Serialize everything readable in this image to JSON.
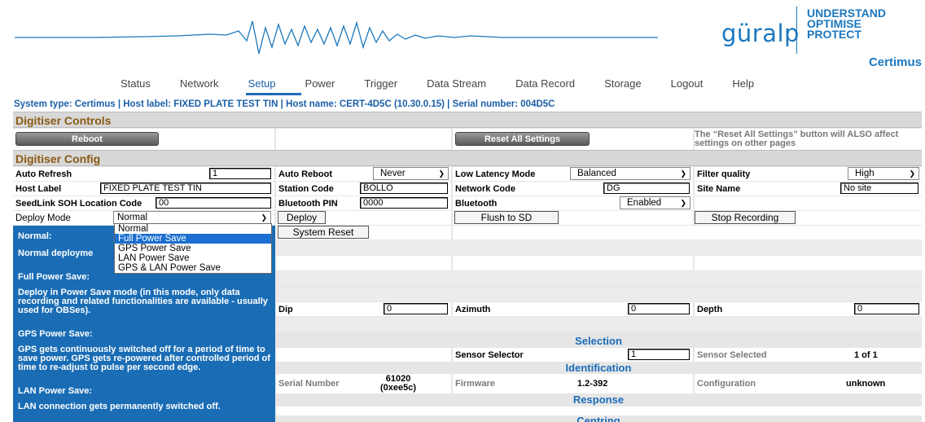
{
  "brand": {
    "logo": "güralp",
    "tagline": [
      "UNDERSTAND",
      "OPTIMISE",
      "PROTECT"
    ],
    "product": "Certimus",
    "accent": "#1b78be"
  },
  "nav": [
    "Status",
    "Network",
    "Setup",
    "Power",
    "Trigger",
    "Data Stream",
    "Data Record",
    "Storage",
    "Logout",
    "Help"
  ],
  "nav_active": "Setup",
  "system_line": "System type: Certimus | Host label: FIXED PLATE TEST TIN | Host name: CERT-4D5C (10.30.0.15) | Serial number: 004D5C",
  "controls": {
    "title": "Digitiser Controls",
    "reboot": "Reboot",
    "reset_all": "Reset All Settings",
    "reset_note": "The “Reset All Settings” button will ALSO affect settings on other pages"
  },
  "config": {
    "title": "Digitiser Config",
    "auto_refresh_label": "Auto Refresh",
    "auto_refresh_value": "1",
    "auto_reboot_label": "Auto Reboot",
    "auto_reboot_value": "Never",
    "low_latency_label": "Low Latency Mode",
    "low_latency_value": "Balanced",
    "filter_quality_label": "Filter quality",
    "filter_quality_value": "High",
    "host_label_label": "Host Label",
    "host_label_value": "FIXED PLATE TEST TIN",
    "station_code_label": "Station Code",
    "station_code_value": "BOLLO",
    "network_code_label": "Network Code",
    "network_code_value": "DG",
    "site_name_label": "Site Name",
    "site_name_value": "No site",
    "seedlink_label": "SeedLink SOH Location Code",
    "seedlink_value": "00",
    "bt_pin_label": "Bluetooth PIN",
    "bt_pin_value": "0000",
    "bluetooth_label": "Bluetooth",
    "bluetooth_value": "Enabled",
    "deploy_mode_label": "Deploy Mode",
    "deploy_mode_value": "Normal",
    "deploy_btn": "Deploy",
    "flush_btn": "Flush to SD",
    "stop_btn": "Stop Recording",
    "system_reset_btn": "System Reset"
  },
  "deploy_options": [
    "Normal",
    "Full Power Save",
    "GPS Power Save",
    "LAN Power Save",
    "GPS & LAN Power Save"
  ],
  "deploy_highlight": "Full Power Save",
  "help": {
    "normal_title": "Normal:",
    "normal_text": "Normal deployme",
    "full_title": "Full Power Save:",
    "full_text": "Deploy in Power Save mode (in this mode, only data recording and related functionalities are available - usually used for OBSes).",
    "gps_title": "GPS Power Save:",
    "gps_text": "GPS gets continuously switched off for a period of time to save power. GPS gets re-powered after controlled period of time to re-adjust to pulse per second edge.",
    "lan_title": "LAN Power Save:",
    "lan_text": "LAN connection gets permanently switched off."
  },
  "orientation": {
    "dip_label": "Dip",
    "dip_value": "0",
    "azimuth_label": "Azimuth",
    "azimuth_value": "0",
    "depth_label": "Depth",
    "depth_value": "0"
  },
  "selection": {
    "title": "Selection",
    "sensor_selector_label": "Sensor Selector",
    "sensor_selector_value": "1",
    "sensor_selected_label": "Sensor Selected",
    "sensor_selected_value": "1 of 1"
  },
  "identification": {
    "title": "Identification",
    "serial_label": "Serial Number",
    "serial_value": "61020",
    "serial_hex": "(0xee5c)",
    "firmware_label": "Firmware",
    "firmware_value": "1.2-392",
    "config_label": "Configuration",
    "config_value": "unknown"
  },
  "response": {
    "title": "Response"
  },
  "centring": {
    "title": "Centring"
  }
}
